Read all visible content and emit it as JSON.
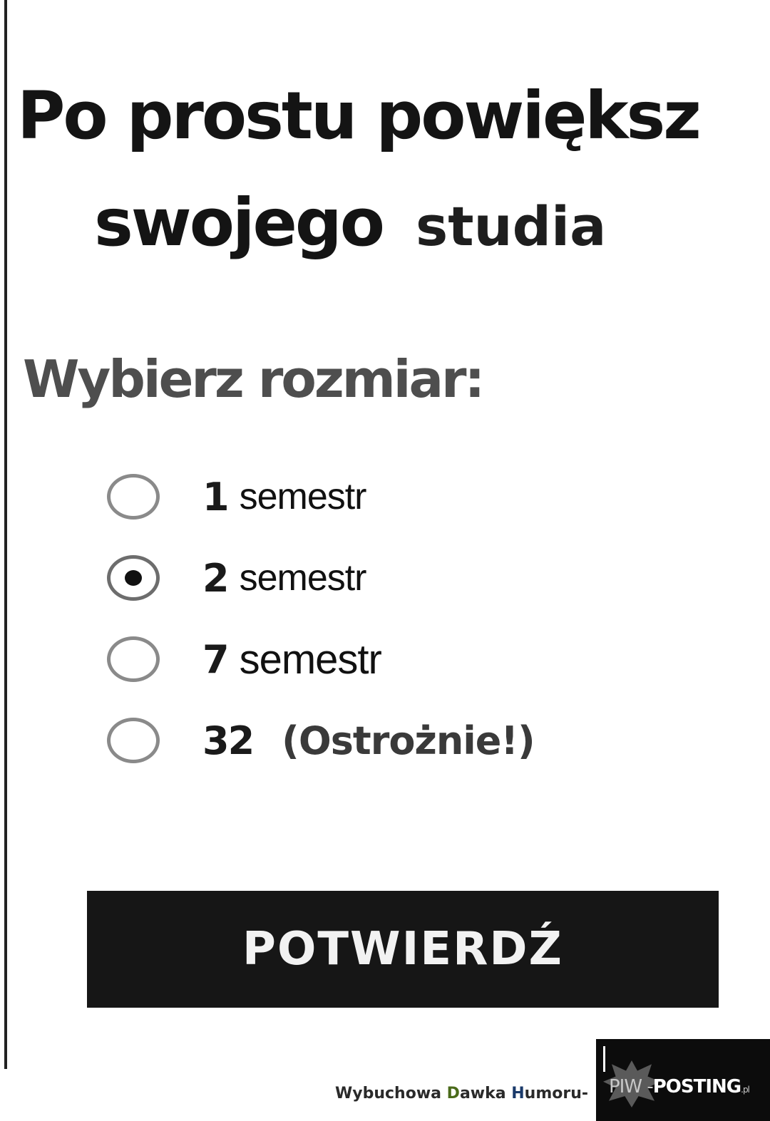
{
  "headline": {
    "line1": "Po prostu powiększ",
    "line2_start": "swojego",
    "line2_patch": "studia"
  },
  "section_title": "Wybierz rozmiar:",
  "options": [
    {
      "number": "1",
      "text": "semestr",
      "checked": false
    },
    {
      "number": "2",
      "text": "semestr",
      "checked": true
    },
    {
      "number": "7",
      "text": "semestr",
      "checked": false
    },
    {
      "number": "32",
      "text": "(Ostrożnie!)",
      "checked": false
    }
  ],
  "confirm_button": "POTWIERDŹ",
  "footer": {
    "credit_part1": "Wybuchowa ",
    "credit_part2": "D",
    "credit_part3": "awka ",
    "credit_part4": "H",
    "credit_part5": "umoru-",
    "logo_left": "PIW",
    "logo_sep": "-",
    "logo_right": "POSTING",
    "logo_suffix": ".pl"
  },
  "colors": {
    "background": "#ffffff",
    "button_bg": "#161616",
    "button_text": "#f2f2f2",
    "section_title": "#4e4e4e"
  },
  "icons": {
    "radio": "radio-circle",
    "radio_checked": "radio-circle-filled",
    "logo": "explosion-burst"
  }
}
